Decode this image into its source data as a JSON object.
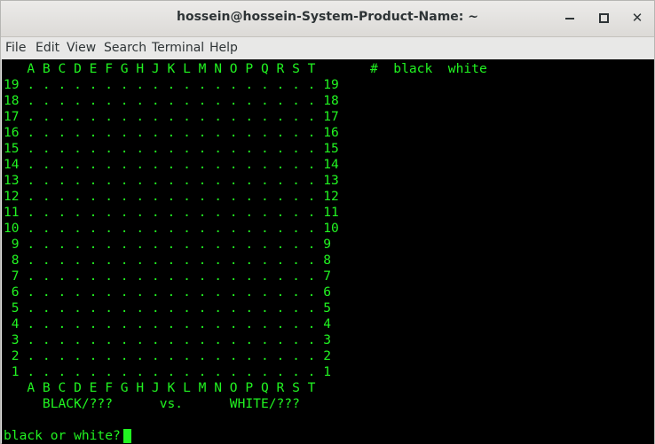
{
  "window": {
    "title": "hossein@hossein-System-Product-Name: ~"
  },
  "menu": [
    "File",
    "Edit",
    "View",
    "Search",
    "Terminal",
    "Help"
  ],
  "terminal": {
    "header": "   A B C D E F G H J K L M N O P Q R S T       #  black  white",
    "rows": [
      "19 . . . . . . . . . . . . . . . . . . . 19",
      "18 . . . . . . . . . . . . . . . . . . . 18",
      "17 . . . . . . . . . . . . . . . . . . . 17",
      "16 . . . . . . . . . . . . . . . . . . . 16",
      "15 . . . . . . . . . . . . . . . . . . . 15",
      "14 . . . . . . . . . . . . . . . . . . . 14",
      "13 . . . . . . . . . . . . . . . . . . . 13",
      "12 . . . . . . . . . . . . . . . . . . . 12",
      "11 . . . . . . . . . . . . . . . . . . . 11",
      "10 . . . . . . . . . . . . . . . . . . . 10",
      " 9 . . . . . . . . . . . . . . . . . . . 9",
      " 8 . . . . . . . . . . . . . . . . . . . 8",
      " 7 . . . . . . . . . . . . . . . . . . . 7",
      " 6 . . . . . . . . . . . . . . . . . . . 6",
      " 5 . . . . . . . . . . . . . . . . . . . 5",
      " 4 . . . . . . . . . . . . . . . . . . . 4",
      " 3 . . . . . . . . . . . . . . . . . . . 3",
      " 2 . . . . . . . . . . . . . . . . . . . 2",
      " 1 . . . . . . . . . . . . . . . . . . . 1"
    ],
    "footer": "   A B C D E F G H J K L M N O P Q R S T",
    "players": "     BLACK/???      vs.      WHITE/???",
    "prompt": "black or white?"
  },
  "colors": {
    "terminal_bg": "#000000",
    "terminal_fg": "#21f321"
  }
}
